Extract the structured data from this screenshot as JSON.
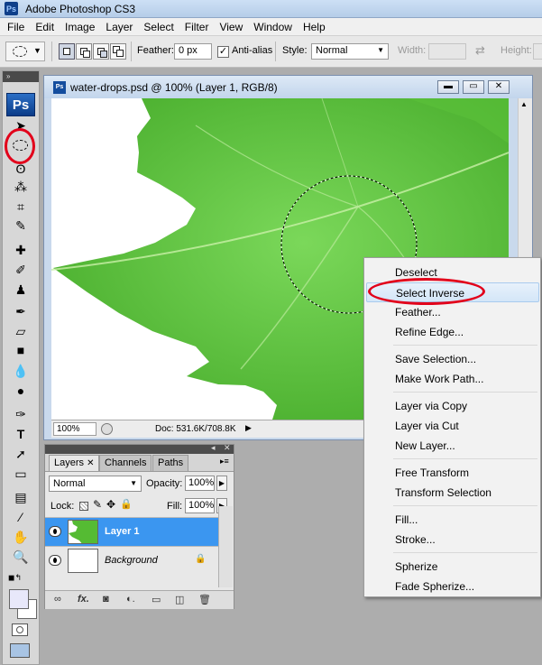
{
  "app": {
    "title": "Adobe Photoshop CS3",
    "logo": "Ps"
  },
  "menubar": {
    "items": [
      "File",
      "Edit",
      "Image",
      "Layer",
      "Select",
      "Filter",
      "View",
      "Window",
      "Help"
    ]
  },
  "options": {
    "feather_label": "Feather:",
    "feather_value": "0 px",
    "antialias_label": "Anti-alias",
    "antialias_checked": true,
    "style_label": "Style:",
    "style_value": "Normal",
    "width_label": "Width:",
    "height_label": "Height:",
    "swap_icon": "swap-arrows-icon"
  },
  "toolbox": {
    "logo": "Ps",
    "tools": [
      "move-icon",
      "elliptical-marquee-icon",
      "lasso-icon",
      "magic-wand-icon",
      "crop-icon",
      "eyedropper-icon",
      "healing-brush-icon",
      "brush-icon",
      "clone-stamp-icon",
      "history-brush-icon",
      "eraser-icon",
      "gradient-icon",
      "blur-icon",
      "dodge-icon",
      "pen-icon",
      "type-icon",
      "path-selection-icon",
      "shape-icon",
      "notes-icon",
      "eyedropper2-icon",
      "hand-icon",
      "zoom-icon"
    ],
    "highlight_color": "#e2001a",
    "foreground_color": "#e8e8fa",
    "background_color": "#ffffff"
  },
  "document": {
    "title": "water-drops.psd @ 100% (Layer 1, RGB/8)",
    "zoom": "100%",
    "doc_info": "Doc: 531.6K/708.8K",
    "leaf_color": "#5cc23a"
  },
  "layers_panel": {
    "tabs": [
      "Layers",
      "Channels",
      "Paths"
    ],
    "blend_mode": "Normal",
    "opacity_label": "Opacity:",
    "opacity_value": "100%",
    "lock_label": "Lock:",
    "fill_label": "Fill:",
    "fill_value": "100%",
    "layers": [
      {
        "name": "Layer 1",
        "selected": true
      },
      {
        "name": "Background",
        "selected": false,
        "locked": true
      }
    ],
    "footer_icons": [
      "link-icon",
      "fx-icon",
      "mask-icon",
      "adjustment-icon",
      "group-icon",
      "new-layer-icon",
      "trash-icon"
    ]
  },
  "context_menu": {
    "items": [
      {
        "label": "Deselect"
      },
      {
        "label": "Select Inverse",
        "highlighted": true
      },
      {
        "label": "Feather..."
      },
      {
        "label": "Refine Edge..."
      },
      {
        "separator": true
      },
      {
        "label": "Save Selection..."
      },
      {
        "label": "Make Work Path..."
      },
      {
        "separator": true
      },
      {
        "label": "Layer via Copy"
      },
      {
        "label": "Layer via Cut"
      },
      {
        "label": "New Layer..."
      },
      {
        "separator": true
      },
      {
        "label": "Free Transform"
      },
      {
        "label": "Transform Selection"
      },
      {
        "separator": true
      },
      {
        "label": "Fill..."
      },
      {
        "label": "Stroke..."
      },
      {
        "separator": true
      },
      {
        "label": "Spherize"
      },
      {
        "label": "Fade Spherize..."
      }
    ]
  }
}
